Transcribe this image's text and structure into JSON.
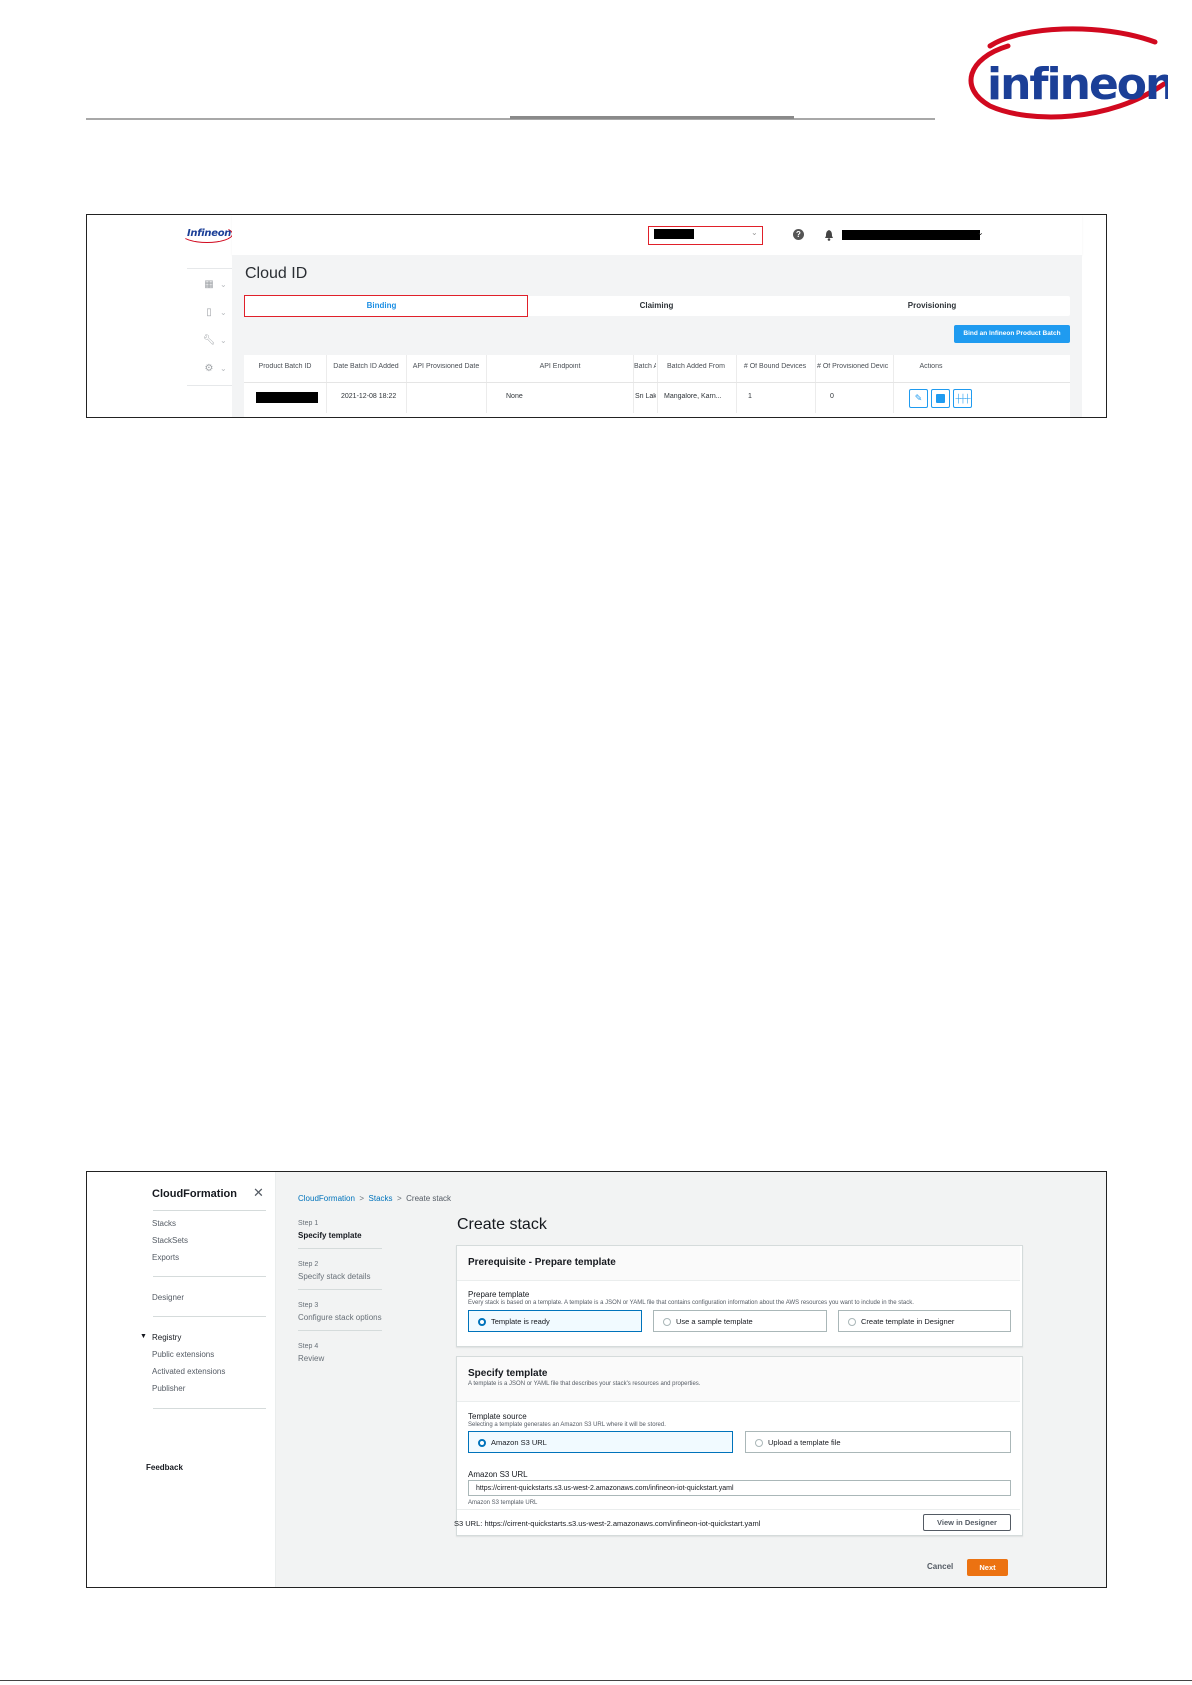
{
  "page": {
    "logo_text": "Infineon",
    "colors": {
      "brand_blue": "#1b3f97",
      "brand_red": "#d1091f"
    }
  },
  "cloud_id": {
    "title": "Cloud ID",
    "tabs": [
      {
        "label": "Binding",
        "active": true
      },
      {
        "label": "Claiming",
        "active": false
      },
      {
        "label": "Provisioning",
        "active": false
      }
    ],
    "bind_button": "Bind an Infineon Product Batch",
    "columns": [
      "Product Batch ID",
      "Date Batch ID Added",
      "API Provisioned Date",
      "API Endpoint",
      "Batch A",
      "Batch Added From",
      "# Of Bound Devices",
      "# Of Provisioned Devic",
      "Actions"
    ],
    "row": {
      "product_batch_id": "",
      "date_added": "2021-12-08 18:22",
      "api_provisioned_date": "",
      "api_endpoint": "None",
      "batch_a": "Sri Lak",
      "added_from": "Mangalore, Karn...",
      "bound_devices": "1",
      "provisioned_devices": "0"
    },
    "action_icons": [
      "edit-icon",
      "trash-icon",
      "settings-sliders-icon"
    ],
    "colors": {
      "accent": "#1f9bf0",
      "highlight": "#e0202a"
    }
  },
  "cloudformation": {
    "brand": "CloudFormation",
    "nav": {
      "group1": [
        "Stacks",
        "StackSets",
        "Exports"
      ],
      "group2": [
        "Designer"
      ],
      "registry_label": "Registry",
      "registry_items": [
        "Public extensions",
        "Activated extensions",
        "Publisher"
      ],
      "feedback": "Feedback"
    },
    "breadcrumb": {
      "item1": "CloudFormation",
      "item2": "Stacks",
      "current": "Create stack"
    },
    "steps": [
      {
        "step": "Step 1",
        "name": "Specify template"
      },
      {
        "step": "Step 2",
        "name": "Specify stack details"
      },
      {
        "step": "Step 3",
        "name": "Configure stack options"
      },
      {
        "step": "Step 4",
        "name": "Review"
      }
    ],
    "page_title": "Create stack",
    "prereq": {
      "heading": "Prerequisite - Prepare template",
      "label": "Prepare template",
      "desc": "Every stack is based on a template. A template is a JSON or YAML file that contains configuration information about the AWS resources you want to include in the stack.",
      "options": [
        "Template is ready",
        "Use a sample template",
        "Create template in Designer"
      ]
    },
    "specify": {
      "heading": "Specify template",
      "desc": "A template is a JSON or YAML file that describes your stack's resources and properties.",
      "source_label": "Template source",
      "source_desc": "Selecting a template generates an Amazon S3 URL where it will be stored.",
      "options": [
        "Amazon S3 URL",
        "Upload a template file"
      ],
      "url_label": "Amazon S3 URL",
      "url_value": "https://cirrent-quickstarts.s3.us-west-2.amazonaws.com/infineon-iot-quickstart.yaml",
      "url_hint": "Amazon S3 template URL",
      "s3_label": "S3 URL:",
      "s3_value": "https://cirrent-quickstarts.s3.us-west-2.amazonaws.com/infineon-iot-quickstart.yaml",
      "view_designer": "View in Designer"
    },
    "cancel": "Cancel",
    "next": "Next",
    "colors": {
      "link": "#0073bb",
      "primary": "#ec7211"
    }
  }
}
